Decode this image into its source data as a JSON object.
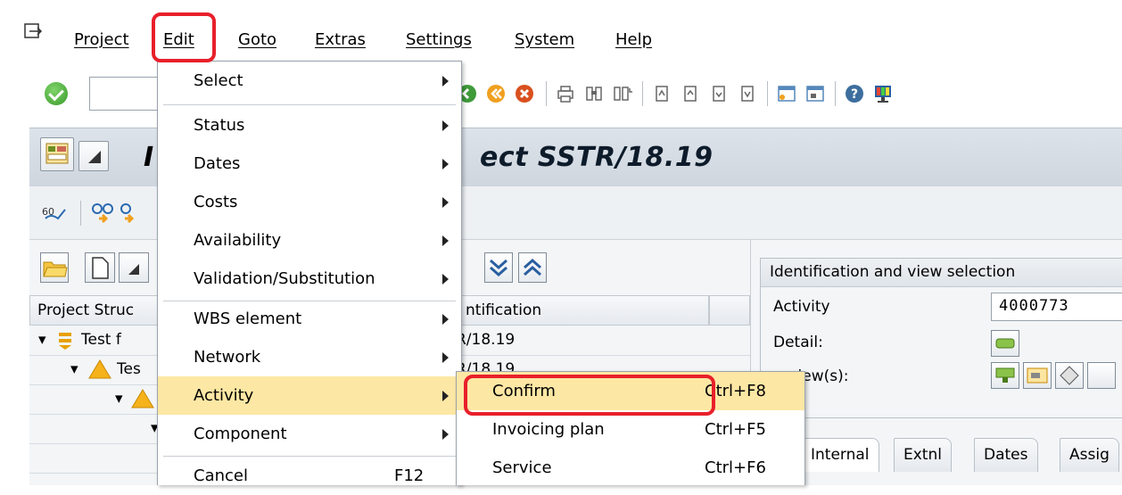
{
  "menubar": {
    "items": [
      {
        "label": "Project"
      },
      {
        "label": "Edit"
      },
      {
        "label": "Goto"
      },
      {
        "label": "Extras"
      },
      {
        "label": "Settings"
      },
      {
        "label": "System"
      },
      {
        "label": "Help"
      }
    ]
  },
  "title": {
    "text": "ect SSTR/18.19"
  },
  "left_panel": {
    "header_col1": "Project Struc",
    "header_col2": "ntification",
    "rows": [
      {
        "col1": "Test f",
        "col2": "R/18.19"
      },
      {
        "col1": "Tes",
        "col2": "R/18.19"
      },
      {
        "col1": "",
        "col2": ""
      },
      {
        "col1": "",
        "col2": ""
      }
    ]
  },
  "right_panel": {
    "group_title": "Identification and view selection",
    "activity_label": "Activity",
    "activity_value": "4000773",
    "detail_label": "Detail:",
    "overview_label": "erview(s):",
    "tabs": [
      {
        "label": "Internal",
        "active": true
      },
      {
        "label": "Extnl"
      },
      {
        "label": "Dates"
      },
      {
        "label": "Assig"
      }
    ]
  },
  "edit_menu": {
    "items": [
      {
        "label": "Select",
        "submenu": true
      },
      {
        "label": "Status",
        "submenu": true
      },
      {
        "label": "Dates",
        "submenu": true
      },
      {
        "label": "Costs",
        "submenu": true
      },
      {
        "label": "Availability",
        "submenu": true
      },
      {
        "label": "Validation/Substitution",
        "submenu": true
      },
      {
        "label": "WBS element",
        "submenu": true
      },
      {
        "label": "Network",
        "submenu": true
      },
      {
        "label": "Activity",
        "submenu": true,
        "highlighted": true
      },
      {
        "label": "Component",
        "submenu": true
      },
      {
        "label": "Cancel",
        "shortcut": "F12"
      }
    ]
  },
  "activity_submenu": {
    "items": [
      {
        "label": "Confirm",
        "shortcut": "Ctrl+F8",
        "highlighted": true
      },
      {
        "label": "Invoicing plan",
        "shortcut": "Ctrl+F5"
      },
      {
        "label": "Service",
        "shortcut": "Ctrl+F6"
      }
    ]
  },
  "colors": {
    "highlight": "#fde7a4",
    "annotation": "#e8202a"
  }
}
